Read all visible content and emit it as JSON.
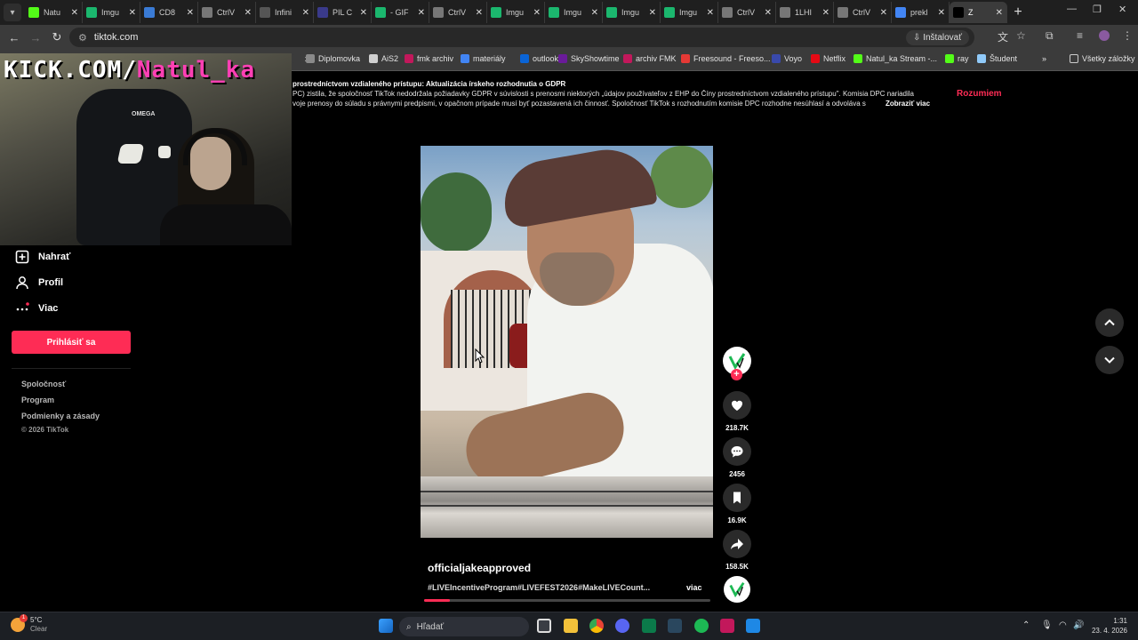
{
  "browser": {
    "tabs": [
      {
        "label": "Natu",
        "color": "#53fc18"
      },
      {
        "label": "Imgu",
        "color": "#1bb76e"
      },
      {
        "label": "CD8",
        "color": "#3a7bd5"
      },
      {
        "label": "CtrlV",
        "color": "#777777"
      },
      {
        "label": "Infini",
        "color": "#555555"
      },
      {
        "label": "PIL C",
        "color": "#3a3a8a"
      },
      {
        "label": "- GIF",
        "color": "#1bb76e"
      },
      {
        "label": "CtrlV",
        "color": "#777777"
      },
      {
        "label": "Imgu",
        "color": "#1bb76e"
      },
      {
        "label": "Imgu",
        "color": "#1bb76e"
      },
      {
        "label": "Imgu",
        "color": "#1bb76e"
      },
      {
        "label": "Imgu",
        "color": "#1bb76e"
      },
      {
        "label": "CtrlV",
        "color": "#777777"
      },
      {
        "label": "1LHI",
        "color": "#777777"
      },
      {
        "label": "CtrlV",
        "color": "#777777"
      },
      {
        "label": "prekl",
        "color": "#4285f4"
      },
      {
        "label": "Z",
        "color": "#000000"
      }
    ],
    "url": "tiktok.com",
    "install_label": "Inštalovať",
    "bookmarks": [
      {
        "label": "x",
        "color": "#3b3b3b"
      },
      {
        "label": "Diplomovka",
        "color": "#8a8a8a"
      },
      {
        "label": "AiS2",
        "color": "#cfcfcf"
      },
      {
        "label": "fmk archiv",
        "color": "#c2185b"
      },
      {
        "label": "materiály",
        "color": "#4285f4"
      },
      {
        "label": "outlook",
        "color": "#0a64d6"
      },
      {
        "label": "SkyShowtime",
        "color": "#6a1b9a"
      },
      {
        "label": "archiv FMK",
        "color": "#c2185b"
      },
      {
        "label": "Freesound - Freeso...",
        "color": "#e53935"
      },
      {
        "label": "Voyo",
        "color": "#3949ab"
      },
      {
        "label": "Netflix",
        "color": "#e50914"
      },
      {
        "label": "Natul_ka Stream -...",
        "color": "#53fc18"
      },
      {
        "label": "ray",
        "color": "#53fc18"
      },
      {
        "label": "Študent",
        "color": "#90caf9"
      }
    ],
    "bookmarks_more": "Všetky záložky"
  },
  "overlay": {
    "white_text": "KICK.COM/",
    "pink_text": "Natul_ka",
    "chair_brand": "OMEGA"
  },
  "gdpr": {
    "title": "prostredníctvom vzdialeného prístupu: Aktualizácia írskeho rozhodnutia o GDPR",
    "line1": "PC) zistila, že spoločnosť TikTok nedodržala požiadavky GDPR v súvislosti s prenosmi niektorých „údajov používateľov z EHP do Číny prostredníctvom vzdialeného prístupu\". Komisia DPC nariadila",
    "line2": "voje prenosy do súladu s právnymi predpismi, v opačnom prípade musí byť pozastavená ich činnosť. Spoločnosť TikTok s rozhodnutím komisie DPC rozhodne nesúhlasí a odvoláva s",
    "more": "Zobraziť viac",
    "accept": "Rozumiem"
  },
  "sidebar": {
    "items": [
      {
        "label": "Nahrať",
        "icon": "upload-icon"
      },
      {
        "label": "Profil",
        "icon": "profile-icon"
      },
      {
        "label": "Viac",
        "icon": "more-icon"
      }
    ],
    "login": "Prihlásiť sa",
    "footer": [
      "Spoločnosť",
      "Program",
      "Podmienky a zásady"
    ],
    "copyright": "© 2026 TikTok"
  },
  "video": {
    "author": "officialjakeapproved",
    "tags": "#LIVEIncentiveProgram#LIVEFEST2026#MakeLIVECount...",
    "more": "viac",
    "progress": 0.09,
    "likes": "218.7K",
    "comments": "2456",
    "saves": "16.9K",
    "shares": "158.5K"
  },
  "taskbar": {
    "temperature": "5°C",
    "condition": "Clear",
    "search_placeholder": "Hľadať",
    "time": "1:31",
    "date": "23. 4. 2026",
    "weather_badge": "1"
  }
}
